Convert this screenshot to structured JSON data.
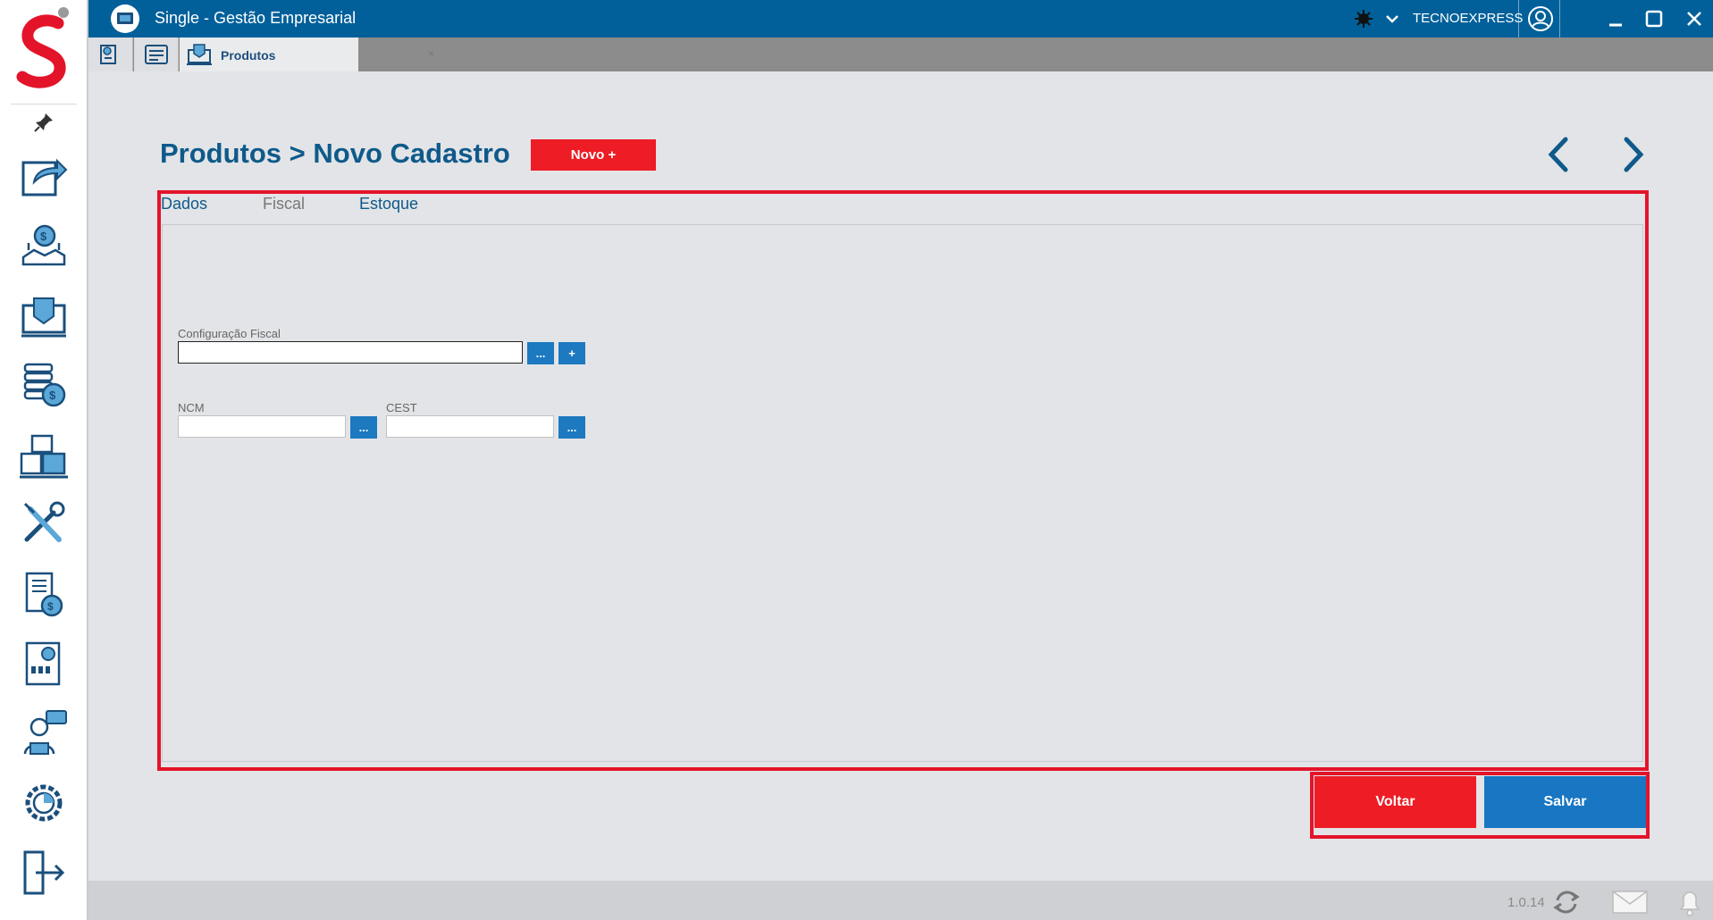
{
  "titlebar": {
    "app_title": "Single - Gestão Empresarial",
    "company": "TECNOEXPRESS"
  },
  "tabs": {
    "active_label": "Produtos",
    "close_glyph": "×"
  },
  "header": {
    "title": "Produtos > Novo Cadastro",
    "novo_label": "Novo +"
  },
  "form_tabs": {
    "dados": "Dados",
    "fiscal": "Fiscal",
    "estoque": "Estoque"
  },
  "fields": {
    "configuracao_fiscal": {
      "label": "Configuração Fiscal",
      "value": ""
    },
    "ncm": {
      "label": "NCM",
      "value": ""
    },
    "cest": {
      "label": "CEST",
      "value": ""
    },
    "lookup_label": "...",
    "add_label": "+"
  },
  "actions": {
    "voltar": "Voltar",
    "salvar": "Salvar"
  },
  "footer": {
    "version": "1.0.14"
  },
  "sidebar_icons": [
    "pin-icon",
    "export-icon",
    "finance-icon",
    "sales-icon",
    "billing-icon",
    "inventory-icon",
    "tools-icon",
    "invoices-icon",
    "reports-icon",
    "support-icon",
    "settings-icon",
    "logout-icon"
  ],
  "colors": {
    "brand_blue": "#01609a",
    "title_blue": "#0e5a8a",
    "accent_red": "#ee1c25",
    "button_blue": "#1876c2",
    "background": "#e3e4e7"
  }
}
